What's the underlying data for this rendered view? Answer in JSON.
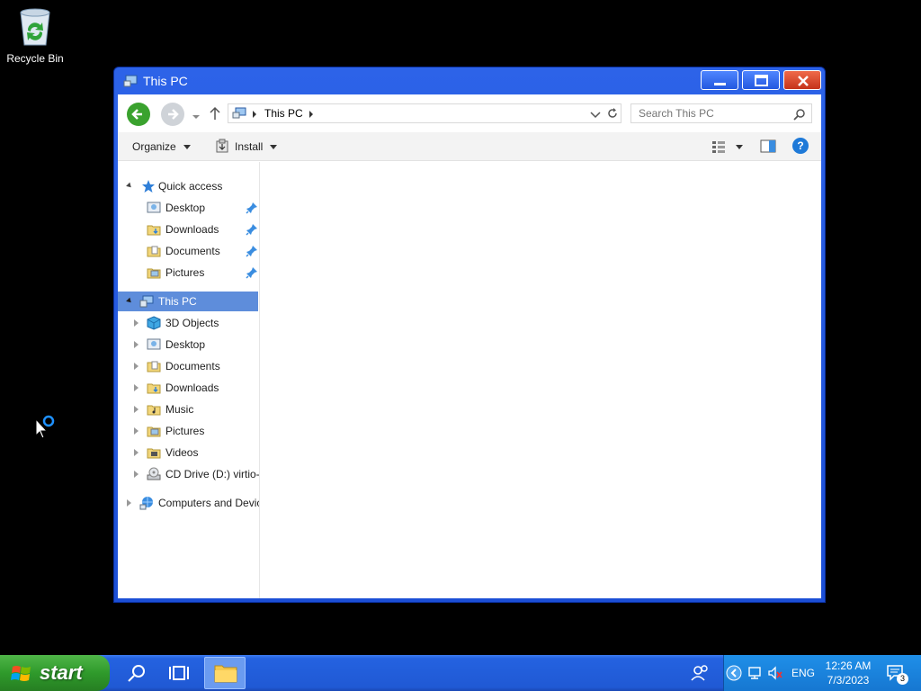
{
  "desktop": {
    "icons": [
      {
        "label": "Recycle Bin",
        "icon": "recycle-bin-icon"
      }
    ]
  },
  "window": {
    "title": "This PC",
    "buttons": {
      "minimize": "minimize",
      "maximize": "maximize",
      "close": "close"
    }
  },
  "address": {
    "crumbs": [
      "This PC"
    ],
    "search_placeholder": "Search This PC"
  },
  "toolbar": {
    "organize_label": "Organize",
    "install_label": "Install"
  },
  "navpane": {
    "quick_access": {
      "label": "Quick access",
      "items": [
        "Desktop",
        "Downloads",
        "Documents",
        "Pictures"
      ]
    },
    "this_pc": {
      "label": "This PC",
      "items": [
        "3D Objects",
        "Desktop",
        "Documents",
        "Downloads",
        "Music",
        "Pictures",
        "Videos",
        "CD Drive (D:) virtio-"
      ]
    },
    "network": {
      "label": "Computers and Devic"
    }
  },
  "taskbar": {
    "start_label": "start",
    "tray": {
      "language": "ENG",
      "time": "12:26 AM",
      "date": "7/3/2023",
      "notification_count": "3"
    }
  },
  "colors": {
    "window_frame": "#2d63e8",
    "selection": "#5e8ddb",
    "start_green": "#2f9a2b",
    "taskbar_blue": "#2059d4"
  }
}
